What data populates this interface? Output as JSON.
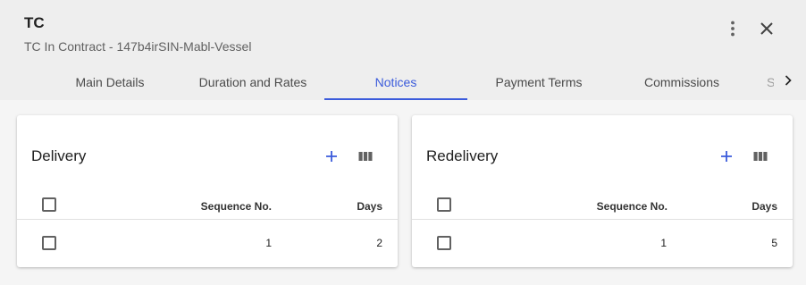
{
  "header": {
    "title": "TC",
    "subtitle": "TC In Contract - 147b4irSIN-Mabl-Vessel"
  },
  "tabs": [
    {
      "label": "Main Details",
      "active": false
    },
    {
      "label": "Duration and Rates",
      "active": false
    },
    {
      "label": "Notices",
      "active": true
    },
    {
      "label": "Payment Terms",
      "active": false
    },
    {
      "label": "Commissions",
      "active": false
    },
    {
      "label": "S",
      "active": false
    }
  ],
  "colors": {
    "accent": "#3b5bdb",
    "icon": "#616161"
  },
  "cards": [
    {
      "title": "Delivery",
      "columns": {
        "sequence": "Sequence No.",
        "days": "Days"
      },
      "rows": [
        {
          "sequence": "1",
          "days": "2"
        }
      ]
    },
    {
      "title": "Redelivery",
      "columns": {
        "sequence": "Sequence No.",
        "days": "Days"
      },
      "rows": [
        {
          "sequence": "1",
          "days": "5"
        }
      ]
    }
  ],
  "icons": {
    "more": "more-vert-icon",
    "close": "close-icon",
    "scroll": "chevron-right-icon",
    "add": "plus-icon",
    "columns": "view-column-icon"
  }
}
